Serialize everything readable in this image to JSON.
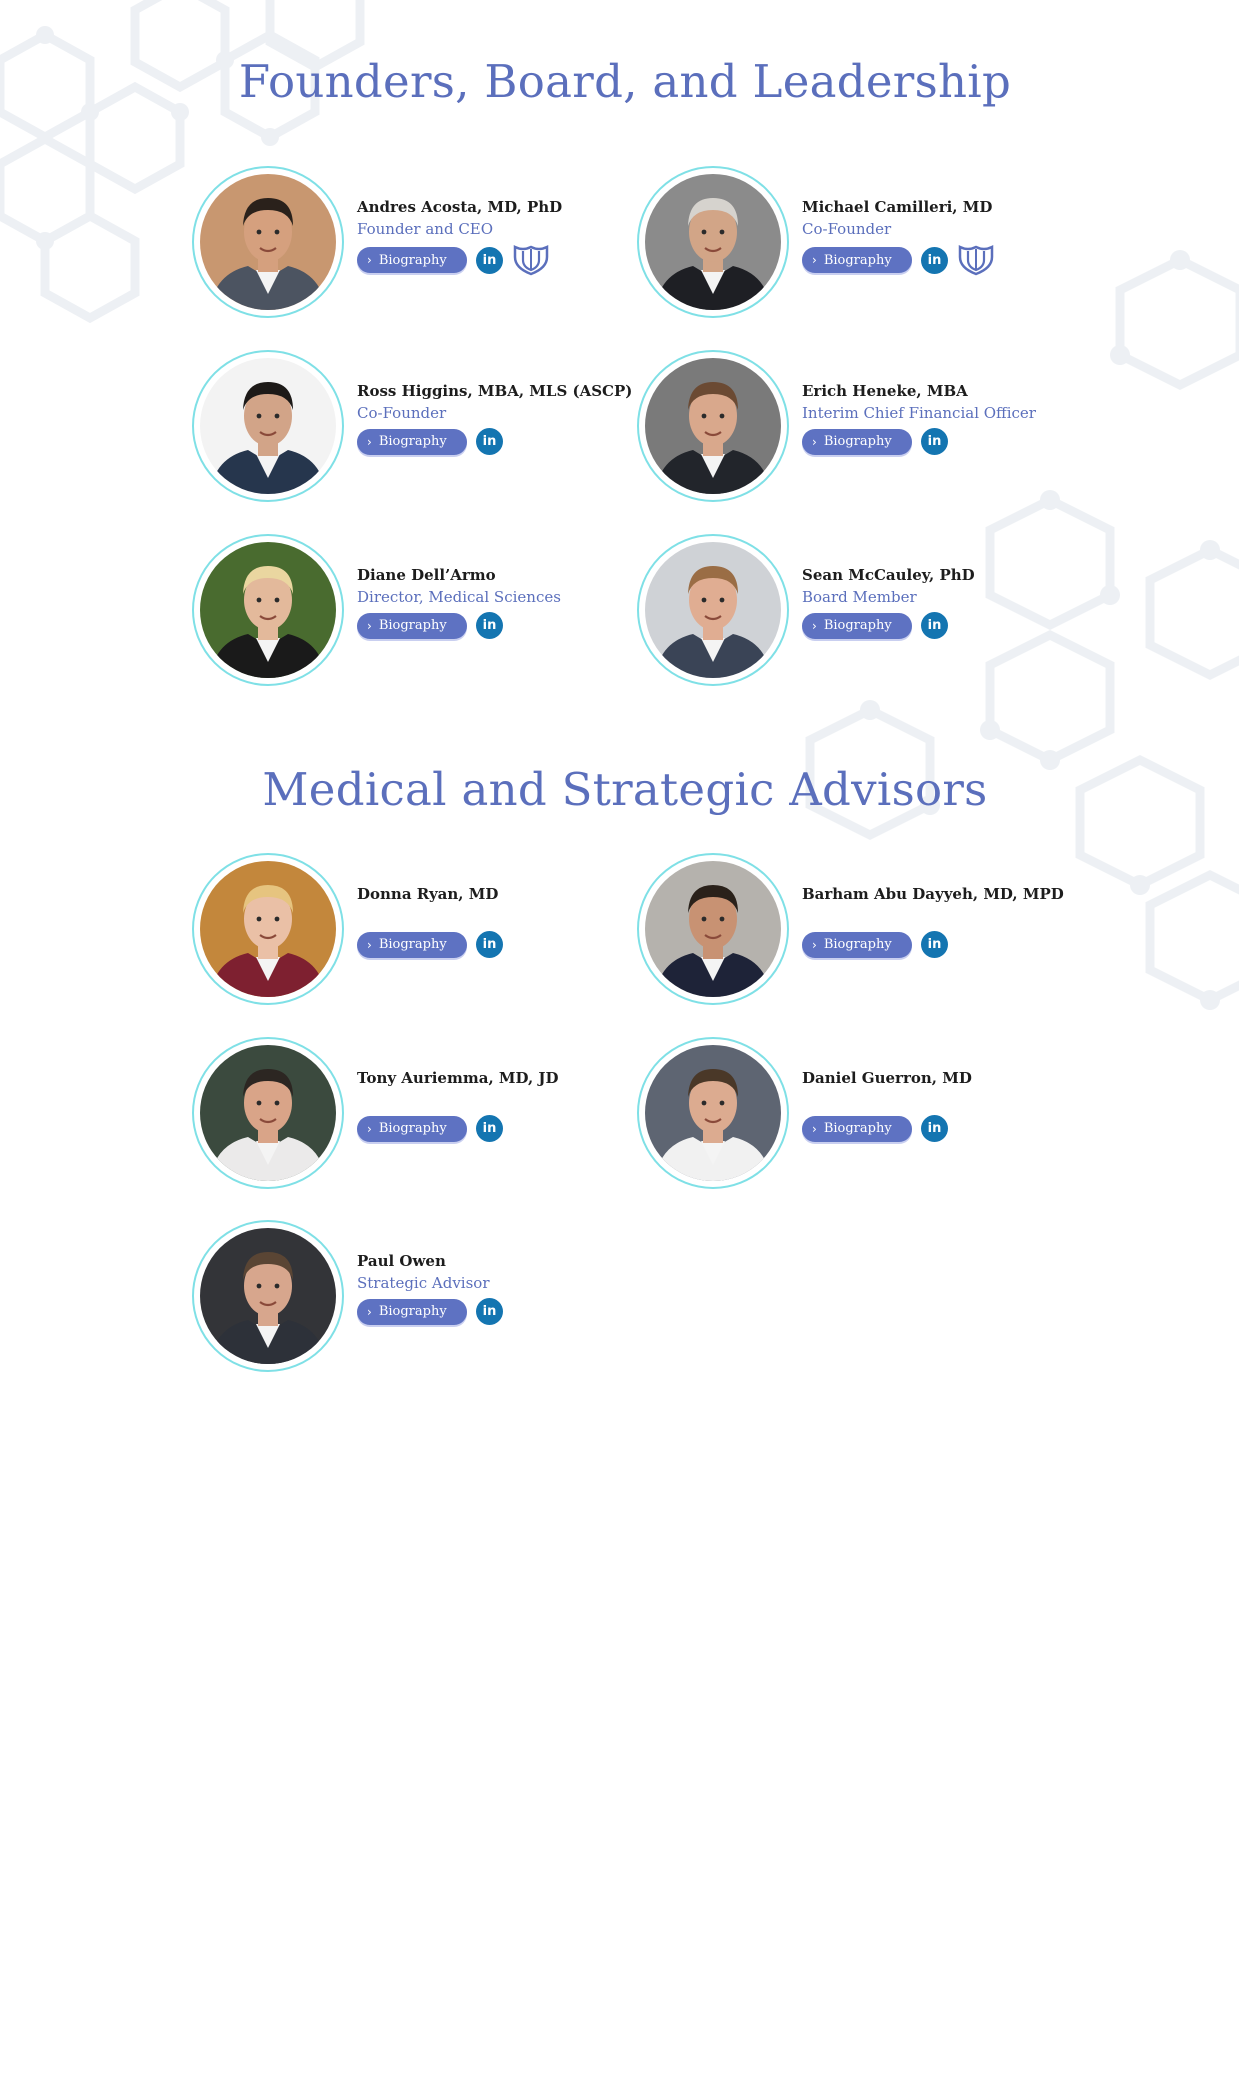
{
  "sections": [
    {
      "title": "Founders, Board, and Leadership",
      "people": [
        {
          "name": "Andres Acosta, MD, PhD",
          "role": "Founder and CEO",
          "bio_label": "Biography",
          "linkedin": "in",
          "icons": [
            "linkedin-icon",
            "mayo-clinic-shield-icon"
          ],
          "photo_bg": "#c89770",
          "skin": "#d5a07e",
          "hair": "#2a211b",
          "suit": "#4c5461"
        },
        {
          "name": "Michael Camilleri, MD",
          "role": "Co-Founder",
          "bio_label": "Biography",
          "linkedin": "in",
          "icons": [
            "linkedin-icon",
            "mayo-clinic-shield-icon"
          ],
          "photo_bg": "#8b8b8b",
          "skin": "#d2a587",
          "hair": "#d6d3ce",
          "suit": "#1e1f24"
        },
        {
          "name": "Ross Higgins, MBA, MLS (ASCP)",
          "role": "Co-Founder",
          "bio_label": "Biography",
          "linkedin": "in",
          "icons": [
            "linkedin-icon"
          ],
          "photo_bg": "#f3f3f3",
          "skin": "#d2a488",
          "hair": "#1d1a18",
          "suit": "#26364d"
        },
        {
          "name": "Erich Heneke, MBA",
          "role": "Interim Chief Financial Officer",
          "bio_label": "Biography",
          "linkedin": "in",
          "icons": [
            "linkedin-icon"
          ],
          "photo_bg": "#7a7a7a",
          "skin": "#d9a88c",
          "hair": "#6b4a33",
          "suit": "#22252b"
        },
        {
          "name": "Diane Dell’Armo",
          "role": "Director, Medical Sciences",
          "bio_label": "Biography",
          "linkedin": "in",
          "icons": [
            "linkedin-icon"
          ],
          "photo_bg": "#496b2f",
          "skin": "#e3b99b",
          "hair": "#ead6a0",
          "suit": "#1a1a1a"
        },
        {
          "name": "Sean McCauley, PhD",
          "role": "Board Member",
          "bio_label": "Biography",
          "linkedin": "in",
          "icons": [
            "linkedin-icon"
          ],
          "photo_bg": "#cfd2d6",
          "skin": "#e0ad92",
          "hair": "#9a6d45",
          "suit": "#3a4456"
        }
      ]
    },
    {
      "title": "Medical and Strategic Advisors",
      "people": [
        {
          "name": "Donna Ryan, MD",
          "role": "",
          "bio_label": "Biography",
          "linkedin": "in",
          "icons": [
            "linkedin-icon"
          ],
          "photo_bg": "#c3873c",
          "skin": "#eac0a6",
          "hair": "#e6c47f",
          "suit": "#7e2030"
        },
        {
          "name": "Barham Abu Dayyeh, MD, MPD",
          "role": "",
          "bio_label": "Biography",
          "linkedin": "in",
          "icons": [
            "linkedin-icon"
          ],
          "photo_bg": "#b5b2ad",
          "skin": "#c89273",
          "hair": "#2a211a",
          "suit": "#1e2338"
        },
        {
          "name": "Tony Auriemma, MD, JD",
          "role": "",
          "bio_label": "Biography",
          "linkedin": "in",
          "icons": [
            "linkedin-icon"
          ],
          "photo_bg": "#3b4a3e",
          "skin": "#d9a488",
          "hair": "#2c2622",
          "suit": "#ebeaea"
        },
        {
          "name": "Daniel Guerron, MD",
          "role": "",
          "bio_label": "Biography",
          "linkedin": "in",
          "icons": [
            "linkedin-icon"
          ],
          "photo_bg": "#5e6572",
          "skin": "#dcab90",
          "hair": "#4a3828",
          "suit": "#f1f1f1"
        },
        {
          "name": "Paul Owen",
          "role": "Strategic Advisor",
          "bio_label": "Biography",
          "linkedin": "in",
          "icons": [
            "linkedin-icon"
          ],
          "photo_bg": "#333438",
          "skin": "#d7a68d",
          "hair": "#5a4534",
          "suit": "#2d3139"
        }
      ]
    }
  ],
  "colors": {
    "accent": "#5b6fbc",
    "button": "#5e72c2",
    "linkedin": "#1475b1",
    "ring": "#7fe0e6",
    "hex_pattern": "#e9ecf2"
  }
}
